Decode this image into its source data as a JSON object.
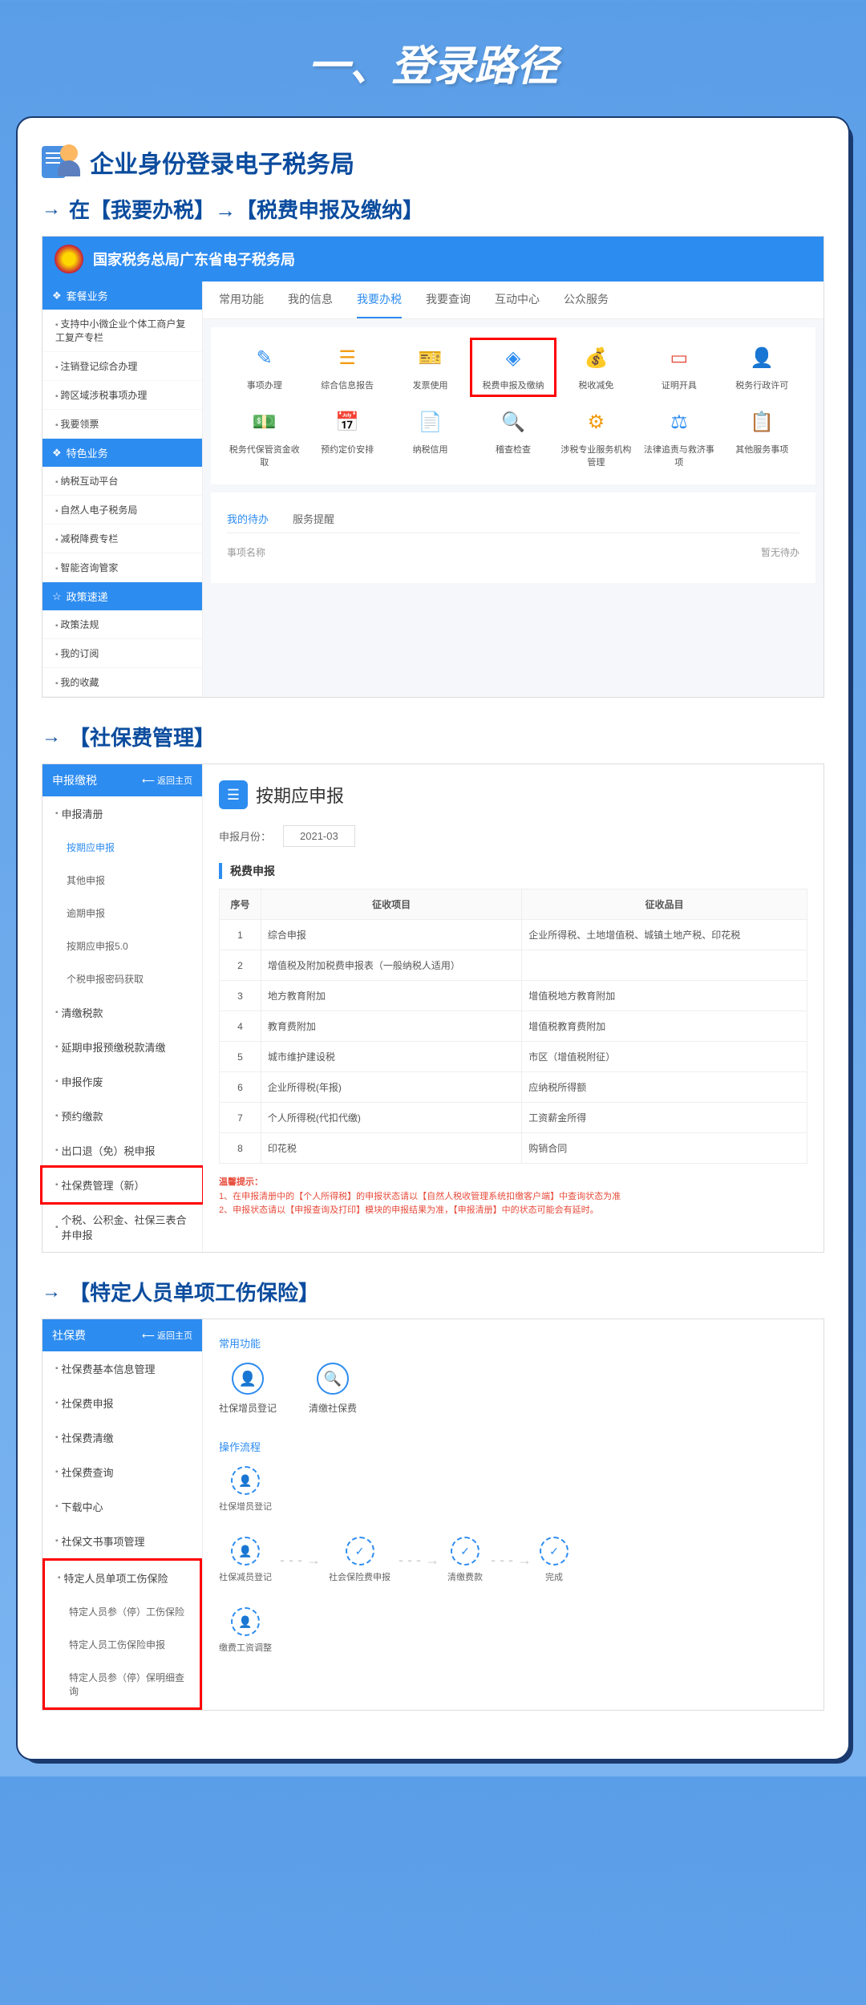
{
  "page_title": "一、登录路径",
  "heading": "企业身份登录电子税务局",
  "step1": "在【我要办税】→【税费申报及缴纳】",
  "step2": "【社保费管理】",
  "step3": "【特定人员单项工伤保险】",
  "ss1": {
    "header": "国家税务总局广东省电子税务局",
    "menu_header1": "套餐业务",
    "side_items": [
      "支持中小微企业个体工商户复工复产专栏",
      "注销登记综合办理",
      "跨区域涉税事项办理",
      "我要领票"
    ],
    "menu_header2": "特色业务",
    "side_items2": [
      "纳税互动平台",
      "自然人电子税务局",
      "减税降费专栏",
      "智能咨询管家"
    ],
    "menu_header3": "政策速递",
    "side_items3": [
      "政策法规",
      "我的订阅",
      "我的收藏"
    ],
    "tabs": [
      "常用功能",
      "我的信息",
      "我要办税",
      "我要查询",
      "互动中心",
      "公众服务"
    ],
    "icons_row1": [
      {
        "icon": "✎",
        "label": "事项办理",
        "color": "#2D8CF0"
      },
      {
        "icon": "☰",
        "label": "综合信息报告",
        "color": "#F39C12"
      },
      {
        "icon": "🎫",
        "label": "发票使用",
        "color": "#E74C3C"
      },
      {
        "icon": "◈",
        "label": "税费申报及缴纳",
        "color": "#2D8CF0",
        "highlight": true
      },
      {
        "icon": "💰",
        "label": "税收减免",
        "color": "#F39C12"
      },
      {
        "icon": "▭",
        "label": "证明开具",
        "color": "#E74C3C"
      },
      {
        "icon": "👤",
        "label": "税务行政许可",
        "color": "#2D8CF0"
      }
    ],
    "icons_row2": [
      {
        "icon": "💵",
        "label": "税务代保管资金收取",
        "color": "#27AE60"
      },
      {
        "icon": "📅",
        "label": "预约定价安排",
        "color": "#2D8CF0"
      },
      {
        "icon": "📄",
        "label": "纳税信用",
        "color": "#F39C12"
      },
      {
        "icon": "🔍",
        "label": "稽查检查",
        "color": "#E74C3C"
      },
      {
        "icon": "⚙",
        "label": "涉税专业服务机构管理",
        "color": "#F39C12"
      },
      {
        "icon": "⚖",
        "label": "法律追责与救济事项",
        "color": "#2D8CF0"
      },
      {
        "icon": "📋",
        "label": "其他服务事项",
        "color": "#27AE60"
      }
    ],
    "todo_tabs": [
      "我的待办",
      "服务提醒"
    ],
    "todo_label": "事项名称",
    "todo_empty": "暂无待办"
  },
  "ss2": {
    "side_title": "申报缴税",
    "back": "⟵ 返回主页",
    "menu": [
      {
        "label": "申报清册",
        "type": "parent"
      },
      {
        "label": "按期应申报",
        "type": "sub",
        "active": true
      },
      {
        "label": "其他申报",
        "type": "sub"
      },
      {
        "label": "逾期申报",
        "type": "sub"
      },
      {
        "label": "按期应申报5.0",
        "type": "sub"
      },
      {
        "label": "个税申报密码获取",
        "type": "sub"
      },
      {
        "label": "清缴税款",
        "type": "parent"
      },
      {
        "label": "延期申报预缴税款清缴",
        "type": "parent"
      },
      {
        "label": "申报作废",
        "type": "parent"
      },
      {
        "label": "预约缴款",
        "type": "parent"
      },
      {
        "label": "出口退（免）税申报",
        "type": "parent"
      },
      {
        "label": "社保费管理（新）",
        "type": "parent",
        "highlight": true
      },
      {
        "label": "个税、公积金、社保三表合并申报",
        "type": "parent"
      }
    ],
    "main_title": "按期应申报",
    "month_label": "申报月份：",
    "month_value": "2021-03",
    "section": "税费申报",
    "table_headers": [
      "序号",
      "征收项目",
      "征收品目"
    ],
    "table_rows": [
      [
        "1",
        "综合申报",
        "企业所得税、土地增值税、城镇土地产税、印花税"
      ],
      [
        "2",
        "增值税及附加税费申报表（一般纳税人适用）",
        ""
      ],
      [
        "3",
        "地方教育附加",
        "增值税地方教育附加"
      ],
      [
        "4",
        "教育费附加",
        "增值税教育费附加"
      ],
      [
        "5",
        "城市维护建设税",
        "市区（增值税附征）"
      ],
      [
        "6",
        "企业所得税(年报)",
        "应纳税所得额"
      ],
      [
        "7",
        "个人所得税(代扣代缴)",
        "工资薪金所得"
      ],
      [
        "8",
        "印花税",
        "购销合同"
      ]
    ],
    "warning_title": "温馨提示：",
    "warning1": "1、在申报清册中的【个人所得税】的申报状态请以【自然人税收管理系统扣缴客户端】中查询状态为准",
    "warning2": "2、申报状态请以【申报查询及打印】模块的申报结果为准，【申报清册】中的状态可能会有延时。"
  },
  "ss3": {
    "side_title": "社保费",
    "back": "⟵ 返回主页",
    "menu": [
      "社保费基本信息管理",
      "社保费申报",
      "社保费清缴",
      "社保费查询",
      "下载中心",
      "社保文书事项管理"
    ],
    "highlight_menu": [
      "特定人员单项工伤保险",
      "特定人员参（停）工伤保险",
      "特定人员工伤保险申报",
      "特定人员参（停）保明细查询"
    ],
    "section1": "常用功能",
    "func_items": [
      {
        "icon": "👤",
        "label": "社保增员登记"
      },
      {
        "icon": "🔍",
        "label": "清缴社保费"
      }
    ],
    "section2": "操作流程",
    "flow": {
      "col1": [
        "社保增员登记",
        "社保减员登记",
        "缴费工资调整"
      ],
      "row": [
        "社会保险费申报",
        "清缴费款",
        "完成"
      ]
    }
  }
}
